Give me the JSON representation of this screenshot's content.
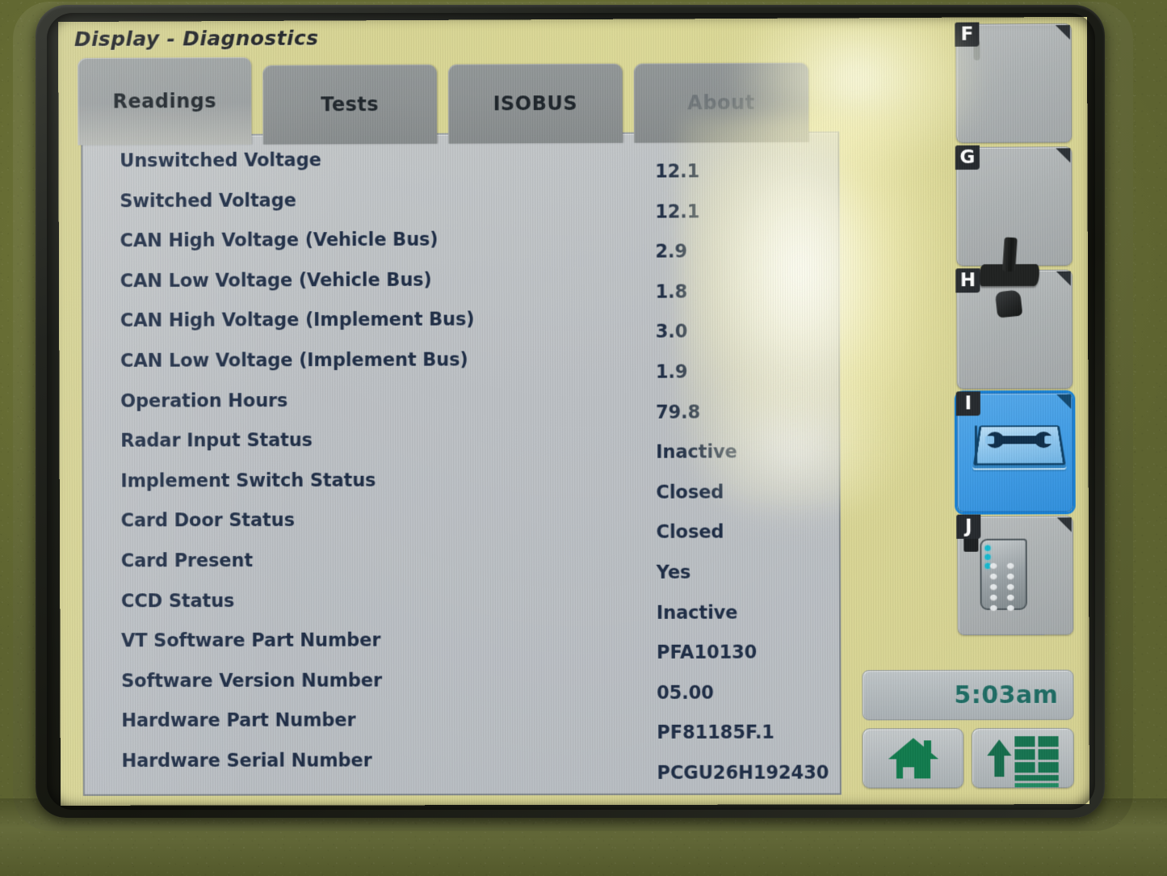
{
  "window": {
    "title": "Display - Diagnostics"
  },
  "tabs": [
    {
      "label": "Readings",
      "state": "active"
    },
    {
      "label": "Tests",
      "state": "normal"
    },
    {
      "label": "ISOBUS",
      "state": "normal"
    },
    {
      "label": "About",
      "state": "dim"
    }
  ],
  "readings": [
    {
      "label": "Unswitched Voltage",
      "value": "12.1"
    },
    {
      "label": "Switched Voltage",
      "value": "12.1"
    },
    {
      "label": "CAN High Voltage (Vehicle Bus)",
      "value": "2.9"
    },
    {
      "label": "CAN Low Voltage (Vehicle Bus)",
      "value": "1.8"
    },
    {
      "label": "CAN High Voltage (Implement Bus)",
      "value": "3.0"
    },
    {
      "label": "CAN Low Voltage (Implement Bus)",
      "value": "1.9"
    },
    {
      "label": "Operation Hours",
      "value": "79.8"
    },
    {
      "label": "Radar Input Status",
      "value": "Inactive"
    },
    {
      "label": "Implement Switch Status",
      "value": "Closed"
    },
    {
      "label": "Card Door Status",
      "value": "Closed"
    },
    {
      "label": "Card Present",
      "value": "Yes"
    },
    {
      "label": "CCD Status",
      "value": "Inactive"
    },
    {
      "label": "VT Software Part Number",
      "value": "PFA10130"
    },
    {
      "label": "Software Version Number",
      "value": "05.00"
    },
    {
      "label": "Hardware Part Number",
      "value": "PF81185F.1"
    },
    {
      "label": "Hardware Serial Number",
      "value": "PCGU26H192430"
    }
  ],
  "softkeys": [
    {
      "key": "F",
      "icon": "display-icon",
      "selected": false
    },
    {
      "key": "G",
      "icon": "globe-icon",
      "selected": false
    },
    {
      "key": "H",
      "icon": "joystick-icon",
      "selected": false
    },
    {
      "key": "I",
      "icon": "manual-wrench-icon",
      "selected": true
    },
    {
      "key": "J",
      "icon": "keypad-icon",
      "selected": false
    }
  ],
  "clock": {
    "time": "5:03am"
  },
  "bottom_buttons": [
    {
      "name": "home",
      "icon": "home-icon"
    },
    {
      "name": "main-menu",
      "icon": "menu-grid-icon"
    }
  ],
  "colors": {
    "app_background": "#d6d291",
    "panel_background": "#bcc0c4",
    "text": "#1c2b44",
    "selected_softkey": "#3f9ce6",
    "clock_text": "#1b6a62",
    "accent_green": "#0e7a4b",
    "housing": "#6a7035"
  }
}
